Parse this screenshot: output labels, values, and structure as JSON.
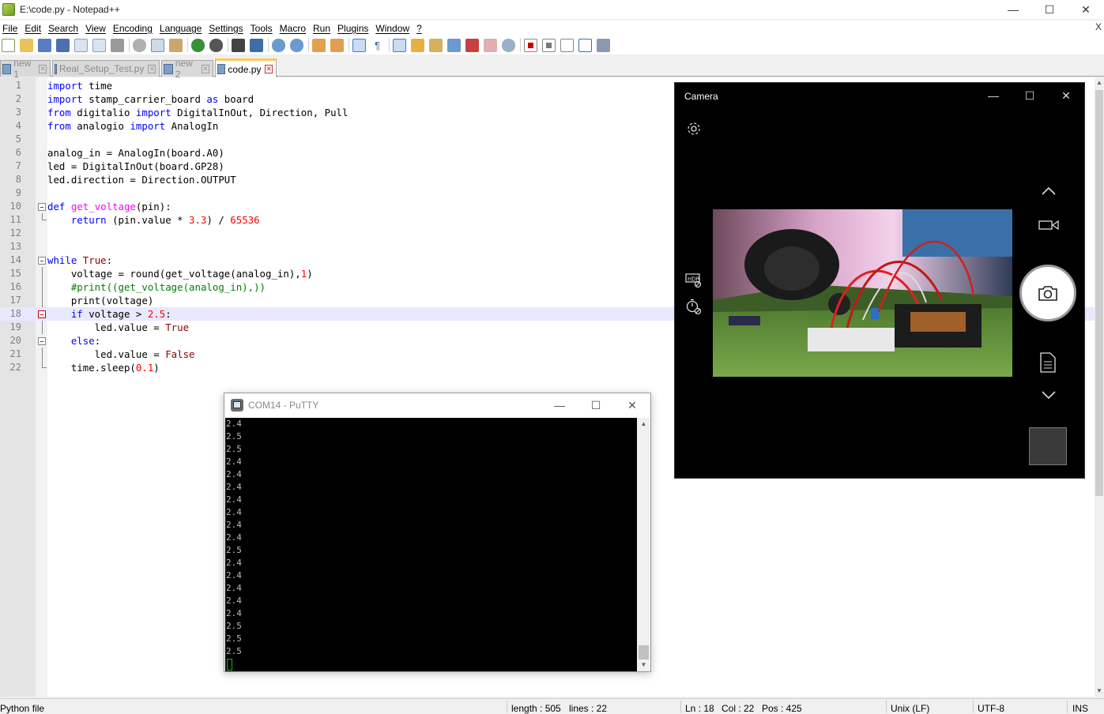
{
  "window": {
    "title": "E:\\code.py - Notepad++",
    "controls": {
      "minimize": "—",
      "maximize": "☐",
      "close": "✕"
    }
  },
  "menu": {
    "items": [
      "File",
      "Edit",
      "Search",
      "View",
      "Encoding",
      "Language",
      "Settings",
      "Tools",
      "Macro",
      "Run",
      "Plugins",
      "Window",
      "?"
    ],
    "close": "X"
  },
  "toolbar": {
    "icons": [
      "new-file-icon",
      "open-file-icon",
      "save-icon",
      "save-all-icon",
      "close-icon",
      "close-all-icon",
      "print-icon",
      "cut-icon",
      "copy-icon",
      "paste-icon",
      "undo-icon",
      "redo-icon",
      "find-icon",
      "replace-icon",
      "zoom-in-icon",
      "zoom-out-icon",
      "sync-v-icon",
      "sync-h-icon",
      "word-wrap-icon",
      "show-all-chars-icon",
      "indent-guide-icon",
      "udl-icon",
      "doc-map-icon",
      "function-list-icon",
      "folder-workspace-icon",
      "monitor-icon",
      "record-macro-icon",
      "stop-macro-icon",
      "play-macro-icon",
      "run-macro-multiple-icon",
      "save-macro-icon"
    ]
  },
  "tabs": [
    {
      "label": "new 1",
      "active": false
    },
    {
      "label": "Real_Setup_Test.py",
      "active": false
    },
    {
      "label": "new 2",
      "active": false
    },
    {
      "label": "code.py",
      "active": true
    }
  ],
  "editor": {
    "current_line": 18,
    "lines": [
      {
        "n": "1",
        "text": "import time"
      },
      {
        "n": "2",
        "text": "import stamp_carrier_board as board"
      },
      {
        "n": "3",
        "text": "from digitalio import DigitalInOut, Direction, Pull"
      },
      {
        "n": "4",
        "text": "from analogio import AnalogIn"
      },
      {
        "n": "5",
        "text": ""
      },
      {
        "n": "6",
        "text": "analog_in = AnalogIn(board.A0)"
      },
      {
        "n": "7",
        "text": "led = DigitalInOut(board.GP28)"
      },
      {
        "n": "8",
        "text": "led.direction = Direction.OUTPUT"
      },
      {
        "n": "9",
        "text": ""
      },
      {
        "n": "10",
        "text": "def get_voltage(pin):"
      },
      {
        "n": "11",
        "text": "    return (pin.value * 3.3) / 65536"
      },
      {
        "n": "12",
        "text": ""
      },
      {
        "n": "13",
        "text": ""
      },
      {
        "n": "14",
        "text": "while True:"
      },
      {
        "n": "15",
        "text": "    voltage = round(get_voltage(analog_in),1)"
      },
      {
        "n": "16",
        "text": "    #print((get_voltage(analog_in),))"
      },
      {
        "n": "17",
        "text": "    print(voltage)"
      },
      {
        "n": "18",
        "text": "    if voltage > 2.5:"
      },
      {
        "n": "19",
        "text": "        led.value = True"
      },
      {
        "n": "20",
        "text": "    else:"
      },
      {
        "n": "21",
        "text": "        led.value = False"
      },
      {
        "n": "22",
        "text": "    time.sleep(0.1)"
      }
    ]
  },
  "statusbar": {
    "language": "Python file",
    "length": "length : 505",
    "lines": "lines : 22",
    "ln": "Ln : 18",
    "col": "Col : 22",
    "pos": "Pos : 425",
    "eol": "Unix (LF)",
    "encoding": "UTF-8",
    "mode": "INS"
  },
  "putty": {
    "title": "COM14 - PuTTY",
    "output": [
      "2.4",
      "2.5",
      "2.5",
      "2.4",
      "2.4",
      "2.4",
      "2.4",
      "2.4",
      "2.4",
      "2.4",
      "2.5",
      "2.4",
      "2.4",
      "2.4",
      "2.4",
      "2.4",
      "2.5",
      "2.5",
      "2.5"
    ],
    "cursor_color": "#00c000"
  },
  "camera": {
    "title": "Camera",
    "icons": [
      "settings-gear-icon",
      "hdr-icon",
      "timer-icon",
      "chevron-up-icon",
      "video-mode-icon",
      "photo-shutter-icon",
      "document-scan-icon",
      "chevron-down-icon",
      "last-photo-thumbnail"
    ]
  },
  "colors": {
    "keyword": "#0000ff",
    "number": "#ff0000",
    "function_def": "#ff00ff",
    "comment": "#008000",
    "current_line_bg": "#e8e8ff",
    "active_tab_accent": "#fac85d"
  }
}
